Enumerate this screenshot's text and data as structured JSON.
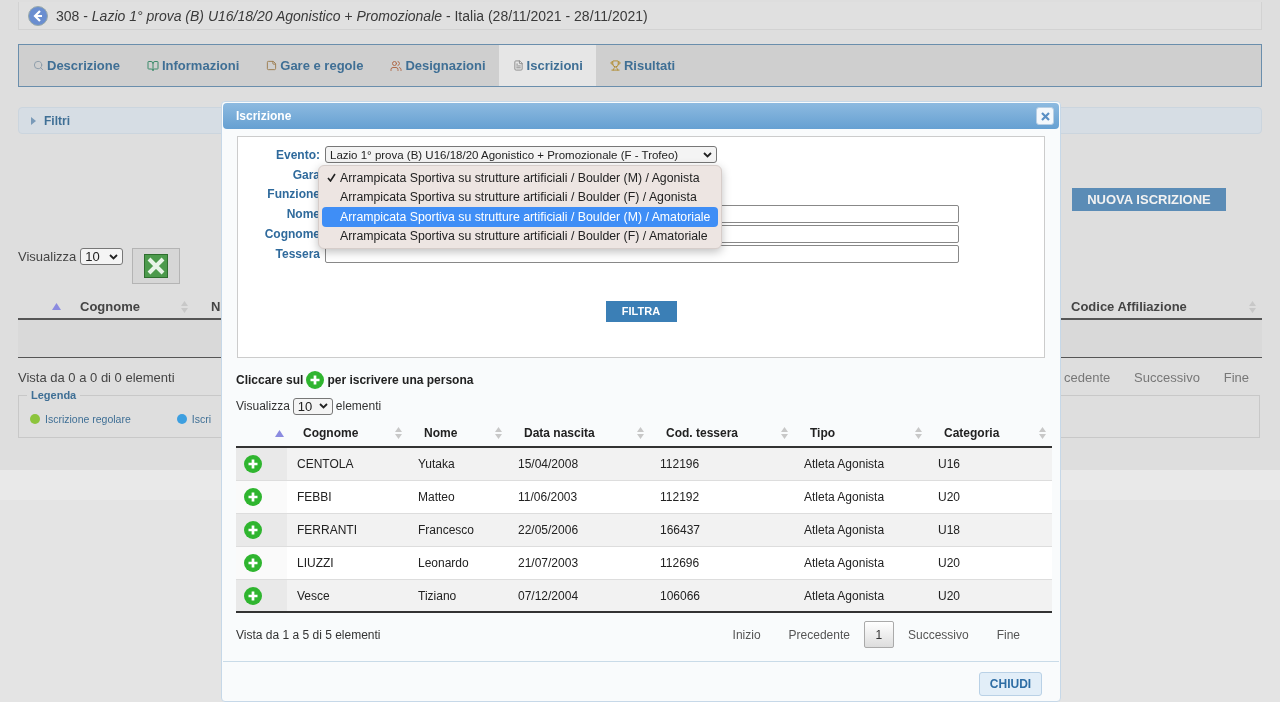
{
  "header": {
    "title": "308 - *Lazio 1° prova (B) U16/18/20 Agonistico + Promozionale* - Italia (28/11/2021 - 28/11/2021)"
  },
  "tabs": [
    {
      "label": "Descrizione",
      "selected": false
    },
    {
      "label": "Informazioni",
      "selected": false
    },
    {
      "label": "Gare e regole",
      "selected": false
    },
    {
      "label": "Designazioni",
      "selected": false
    },
    {
      "label": "Iscrizioni",
      "selected": true
    },
    {
      "label": "Risultati",
      "selected": false
    }
  ],
  "filters_bar": {
    "label": "Filtri"
  },
  "new_button": "NUOVA ISCRIZIONE",
  "page_size": {
    "label": "Visualizza",
    "value": "10"
  },
  "main_table": {
    "marker_column": {
      "sorted": true
    },
    "columns": [
      {
        "label": "Cognome",
        "sorted": false
      },
      {
        "label": "N"
      },
      {
        "label": "Codice Affiliazione",
        "sorted": false
      }
    ]
  },
  "main_info": "Vista da 0 a 0 di 0 elementi",
  "main_pager": [
    "cedente",
    "Successivo",
    "Fine"
  ],
  "legend": {
    "title": "Legenda",
    "items": [
      {
        "label": "Iscrizione regolare",
        "color": "#8cc43c"
      },
      {
        "label": "Iscri",
        "color": "#3d9fe0"
      }
    ]
  },
  "dialog": {
    "title": "Iscrizione",
    "fields": [
      {
        "label": "Evento:",
        "kind": "select",
        "value": "Lazio 1° prova (B) U16/18/20 Agonistico + Promozionale (F - Trofeo)"
      },
      {
        "label": "Gara",
        "kind": "covered"
      },
      {
        "label": "Funzione",
        "kind": "covered"
      },
      {
        "label": "Nome",
        "kind": "input"
      },
      {
        "label": "Cognome",
        "kind": "input"
      },
      {
        "label": "Tessera",
        "kind": "input"
      }
    ],
    "dropdown": {
      "options": [
        {
          "label": "Arrampicata Sportiva su strutture artificiali / Boulder (M) / Agonista",
          "selected": true,
          "highlighted": false
        },
        {
          "label": "Arrampicata Sportiva su strutture artificiali / Boulder (F) / Agonista",
          "selected": false,
          "highlighted": false
        },
        {
          "label": "Arrampicata Sportiva su strutture artificiali / Boulder (M) / Amatoriale",
          "selected": false,
          "highlighted": true
        },
        {
          "label": "Arrampicata Sportiva su strutture artificiali / Boulder (F) / Amatoriale",
          "selected": false,
          "highlighted": false
        }
      ]
    },
    "filter_button": "FILTRA",
    "hint": {
      "before": "Cliccare sul",
      "after": "per iscrivere una persona"
    },
    "page_size": {
      "label": "Visualizza",
      "value": "10",
      "suffix": "elementi"
    },
    "table": {
      "marker_column": {
        "sorted": true
      },
      "columns": [
        {
          "label": "Cognome",
          "sorted": false
        },
        {
          "label": "Nome",
          "sorted": false
        },
        {
          "label": "Data nascita",
          "sorted": false
        },
        {
          "label": "Cod. tessera",
          "sorted": false
        },
        {
          "label": "Tipo",
          "sorted": false
        },
        {
          "label": "Categoria",
          "sorted": false
        }
      ],
      "rows": [
        {
          "cells": [
            "CENTOLA",
            "Yutaka",
            "15/04/2008",
            "112196",
            "Atleta Agonista",
            "U16"
          ]
        },
        {
          "cells": [
            "FEBBI",
            "Matteo",
            "11/06/2003",
            "112192",
            "Atleta Agonista",
            "U20"
          ]
        },
        {
          "cells": [
            "FERRANTI",
            "Francesco",
            "22/05/2006",
            "166437",
            "Atleta Agonista",
            "U18"
          ]
        },
        {
          "cells": [
            "LIUZZI",
            "Leonardo",
            "21/07/2003",
            "112696",
            "Atleta Agonista",
            "U20"
          ]
        },
        {
          "cells": [
            "Vesce",
            "Tiziano",
            "07/12/2004",
            "106066",
            "Atleta Agonista",
            "U20"
          ]
        }
      ]
    },
    "info": "Vista da 1 a 5 di 5 elementi",
    "pager": [
      {
        "label": "Inizio",
        "kind": "link"
      },
      {
        "label": "Precedente",
        "kind": "link"
      },
      {
        "label": "1",
        "kind": "page",
        "selected": true
      },
      {
        "label": "Successivo",
        "kind": "link"
      },
      {
        "label": "Fine",
        "kind": "link"
      }
    ],
    "close_button": "CHIUDI"
  }
}
